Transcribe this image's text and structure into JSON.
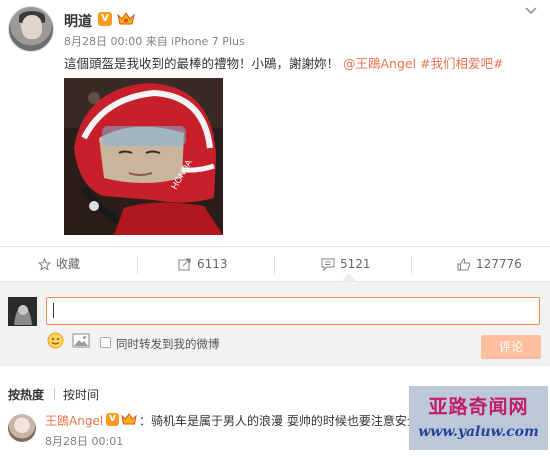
{
  "post": {
    "username": "明道",
    "verified_badge": "V",
    "meta": "8月28日 00:00 来自 iPhone 7 Plus",
    "text_main": "這個頭盔是我收到的最棒的禮物！小鴎，謝謝妳！",
    "mention": "@王鴎Angel",
    "hashtag": "#我们相爱吧#",
    "photo_icon": "helmet-photo"
  },
  "actions": {
    "favorite_label": "收藏",
    "repost_count": "6113",
    "comment_count": "5121",
    "like_count": "127776"
  },
  "compose": {
    "input_value": "",
    "repost_option_label": "同时转发到我的微博",
    "submit_label": "评论"
  },
  "sort_tabs": {
    "hot": "按热度",
    "time": "按时间"
  },
  "comment": {
    "username": "王鴎Angel",
    "verified_badge": "V",
    "text": "：骑机车是属于男人的浪漫 耍帅的时候也要注意安全",
    "time": "8月28日 00:01"
  },
  "watermark": {
    "title": "亚路奇闻网",
    "url": "www.yaluw.com"
  },
  "colors": {
    "accent": "#eb7350",
    "submit_disabled": "#ffc09f",
    "compose_bg": "#f2f2f5"
  }
}
